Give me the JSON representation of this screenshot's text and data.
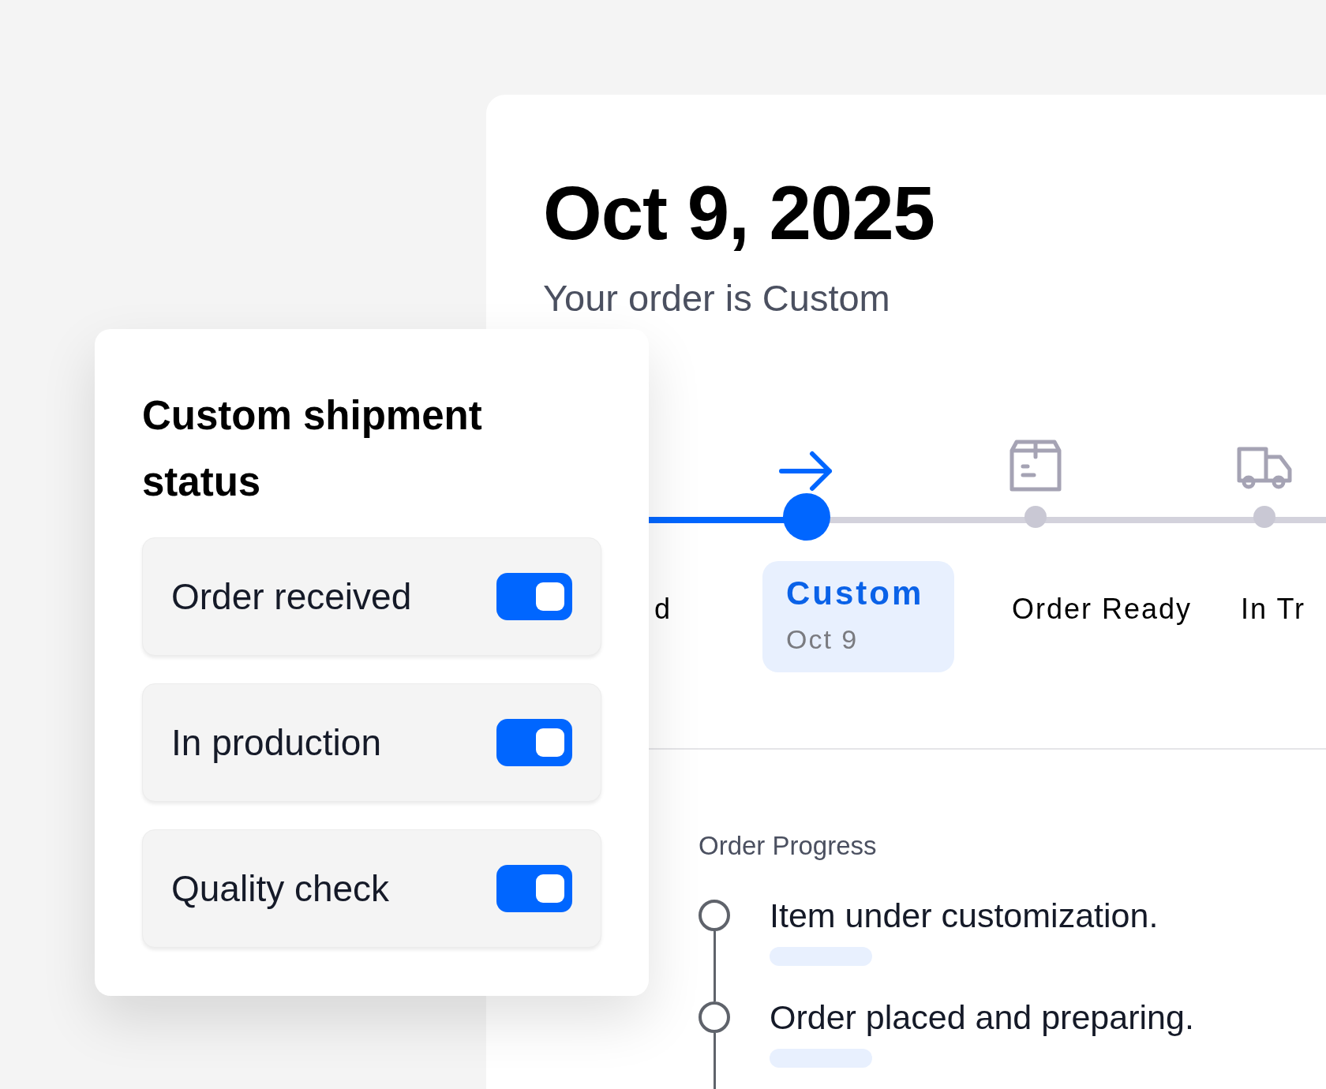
{
  "order": {
    "date": "Oct 9, 2025",
    "subtitle": "Your order is Custom"
  },
  "stepper": [
    {
      "label": "d",
      "current": false
    },
    {
      "label": "Custom",
      "date": "Oct 9",
      "current": true
    },
    {
      "label": "Order Ready",
      "current": false
    },
    {
      "label": "In Tr",
      "current": false
    }
  ],
  "progress": {
    "title": "Order Progress",
    "items": [
      {
        "text": "Item under customization."
      },
      {
        "text": "Order placed and preparing."
      }
    ]
  },
  "status_panel": {
    "title": "Custom shipment status",
    "toggles": [
      {
        "label": "Order received",
        "on": true
      },
      {
        "label": "In production",
        "on": true
      },
      {
        "label": "Quality check",
        "on": true
      }
    ]
  }
}
